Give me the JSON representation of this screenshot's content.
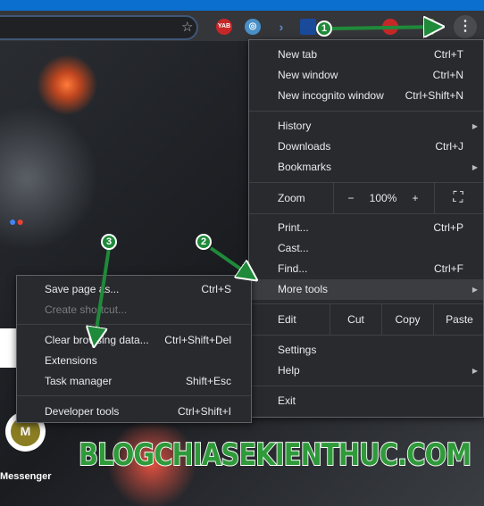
{
  "toolbar": {
    "ext_yab": "YAB",
    "kebab": "⋮"
  },
  "main_menu": {
    "new_tab": {
      "label": "New tab",
      "shortcut": "Ctrl+T"
    },
    "new_window": {
      "label": "New window",
      "shortcut": "Ctrl+N"
    },
    "new_incognito": {
      "label": "New incognito window",
      "shortcut": "Ctrl+Shift+N"
    },
    "history": {
      "label": "History"
    },
    "downloads": {
      "label": "Downloads",
      "shortcut": "Ctrl+J"
    },
    "bookmarks": {
      "label": "Bookmarks"
    },
    "zoom": {
      "label": "Zoom",
      "minus": "−",
      "value": "100%",
      "plus": "+"
    },
    "print": {
      "label": "Print...",
      "shortcut": "Ctrl+P"
    },
    "cast": {
      "label": "Cast..."
    },
    "find": {
      "label": "Find...",
      "shortcut": "Ctrl+F"
    },
    "more_tools": {
      "label": "More tools"
    },
    "edit": {
      "label": "Edit",
      "cut": "Cut",
      "copy": "Copy",
      "paste": "Paste"
    },
    "settings": {
      "label": "Settings"
    },
    "help": {
      "label": "Help"
    },
    "exit": {
      "label": "Exit"
    }
  },
  "sub_menu": {
    "save_page": {
      "label": "Save page as...",
      "shortcut": "Ctrl+S"
    },
    "create_shortcut": {
      "label": "Create shortcut..."
    },
    "clear_data": {
      "label": "Clear browsing data...",
      "shortcut": "Ctrl+Shift+Del"
    },
    "extensions": {
      "label": "Extensions"
    },
    "task_manager": {
      "label": "Task manager",
      "shortcut": "Shift+Esc"
    },
    "dev_tools": {
      "label": "Developer tools",
      "shortcut": "Ctrl+Shift+I"
    }
  },
  "page": {
    "avatar_letter": "M",
    "shortcut_label": "Messenger"
  },
  "annotations": {
    "step1": "1",
    "step2": "2",
    "step3": "3",
    "arrow_color": "#1f8a3a"
  },
  "watermark": "BLOGCHIASEKIENTHUC.COM"
}
